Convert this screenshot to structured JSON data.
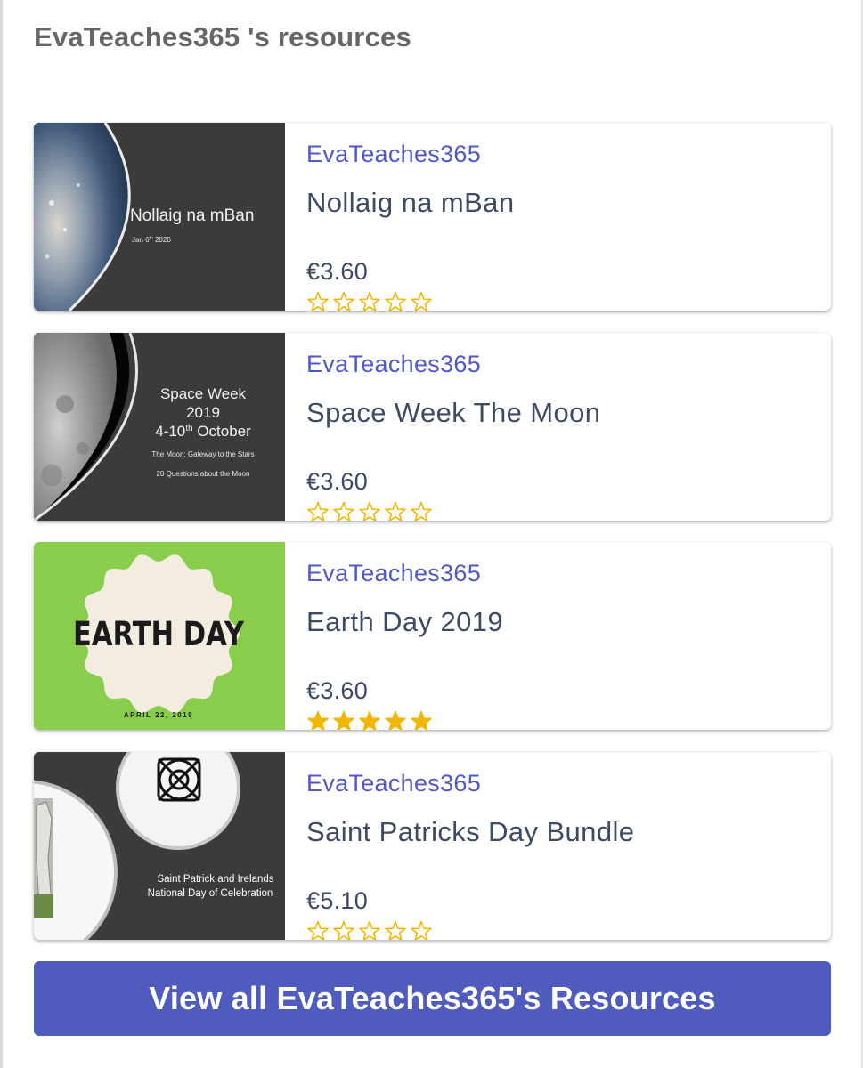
{
  "page": {
    "heading": "EvaTeaches365 's resources"
  },
  "colors": {
    "author": "#5158c8",
    "title": "#3d4a64",
    "star": "#f2b705",
    "button": "#4f5bbd",
    "heading": "#666666"
  },
  "resources": [
    {
      "author": "EvaTeaches365",
      "title": "Nollaig na mBan",
      "price": "€3.60",
      "rating": 0,
      "thumbnail": {
        "title": "Nollaig na mBan",
        "date_main": "Jan 6",
        "date_sup": "th",
        "date_year": " 2020"
      }
    },
    {
      "author": "EvaTeaches365",
      "title": "Space Week The Moon",
      "price": "€3.60",
      "rating": 0,
      "thumbnail": {
        "line1": "Space Week",
        "line2": "2019",
        "line3_a": "4-10",
        "line3_sup": "th",
        "line3_b": " October",
        "sub1": "The Moon: Gateway to the Stars",
        "sub2": "20 Questions about the Moon"
      }
    },
    {
      "author": "EvaTeaches365",
      "title": "Earth Day 2019",
      "price": "€3.60",
      "rating": 5,
      "thumbnail": {
        "title": "EARTH DAY",
        "date": "APRIL 22, 2019"
      }
    },
    {
      "author": "EvaTeaches365",
      "title": "Saint Patricks Day Bundle",
      "price": "€5.10",
      "rating": 0,
      "thumbnail": {
        "line1": "Saint Patrick and Irelands",
        "line2": "National Day of Celebration"
      }
    }
  ],
  "cta": {
    "label": "View all EvaTeaches365's Resources"
  }
}
